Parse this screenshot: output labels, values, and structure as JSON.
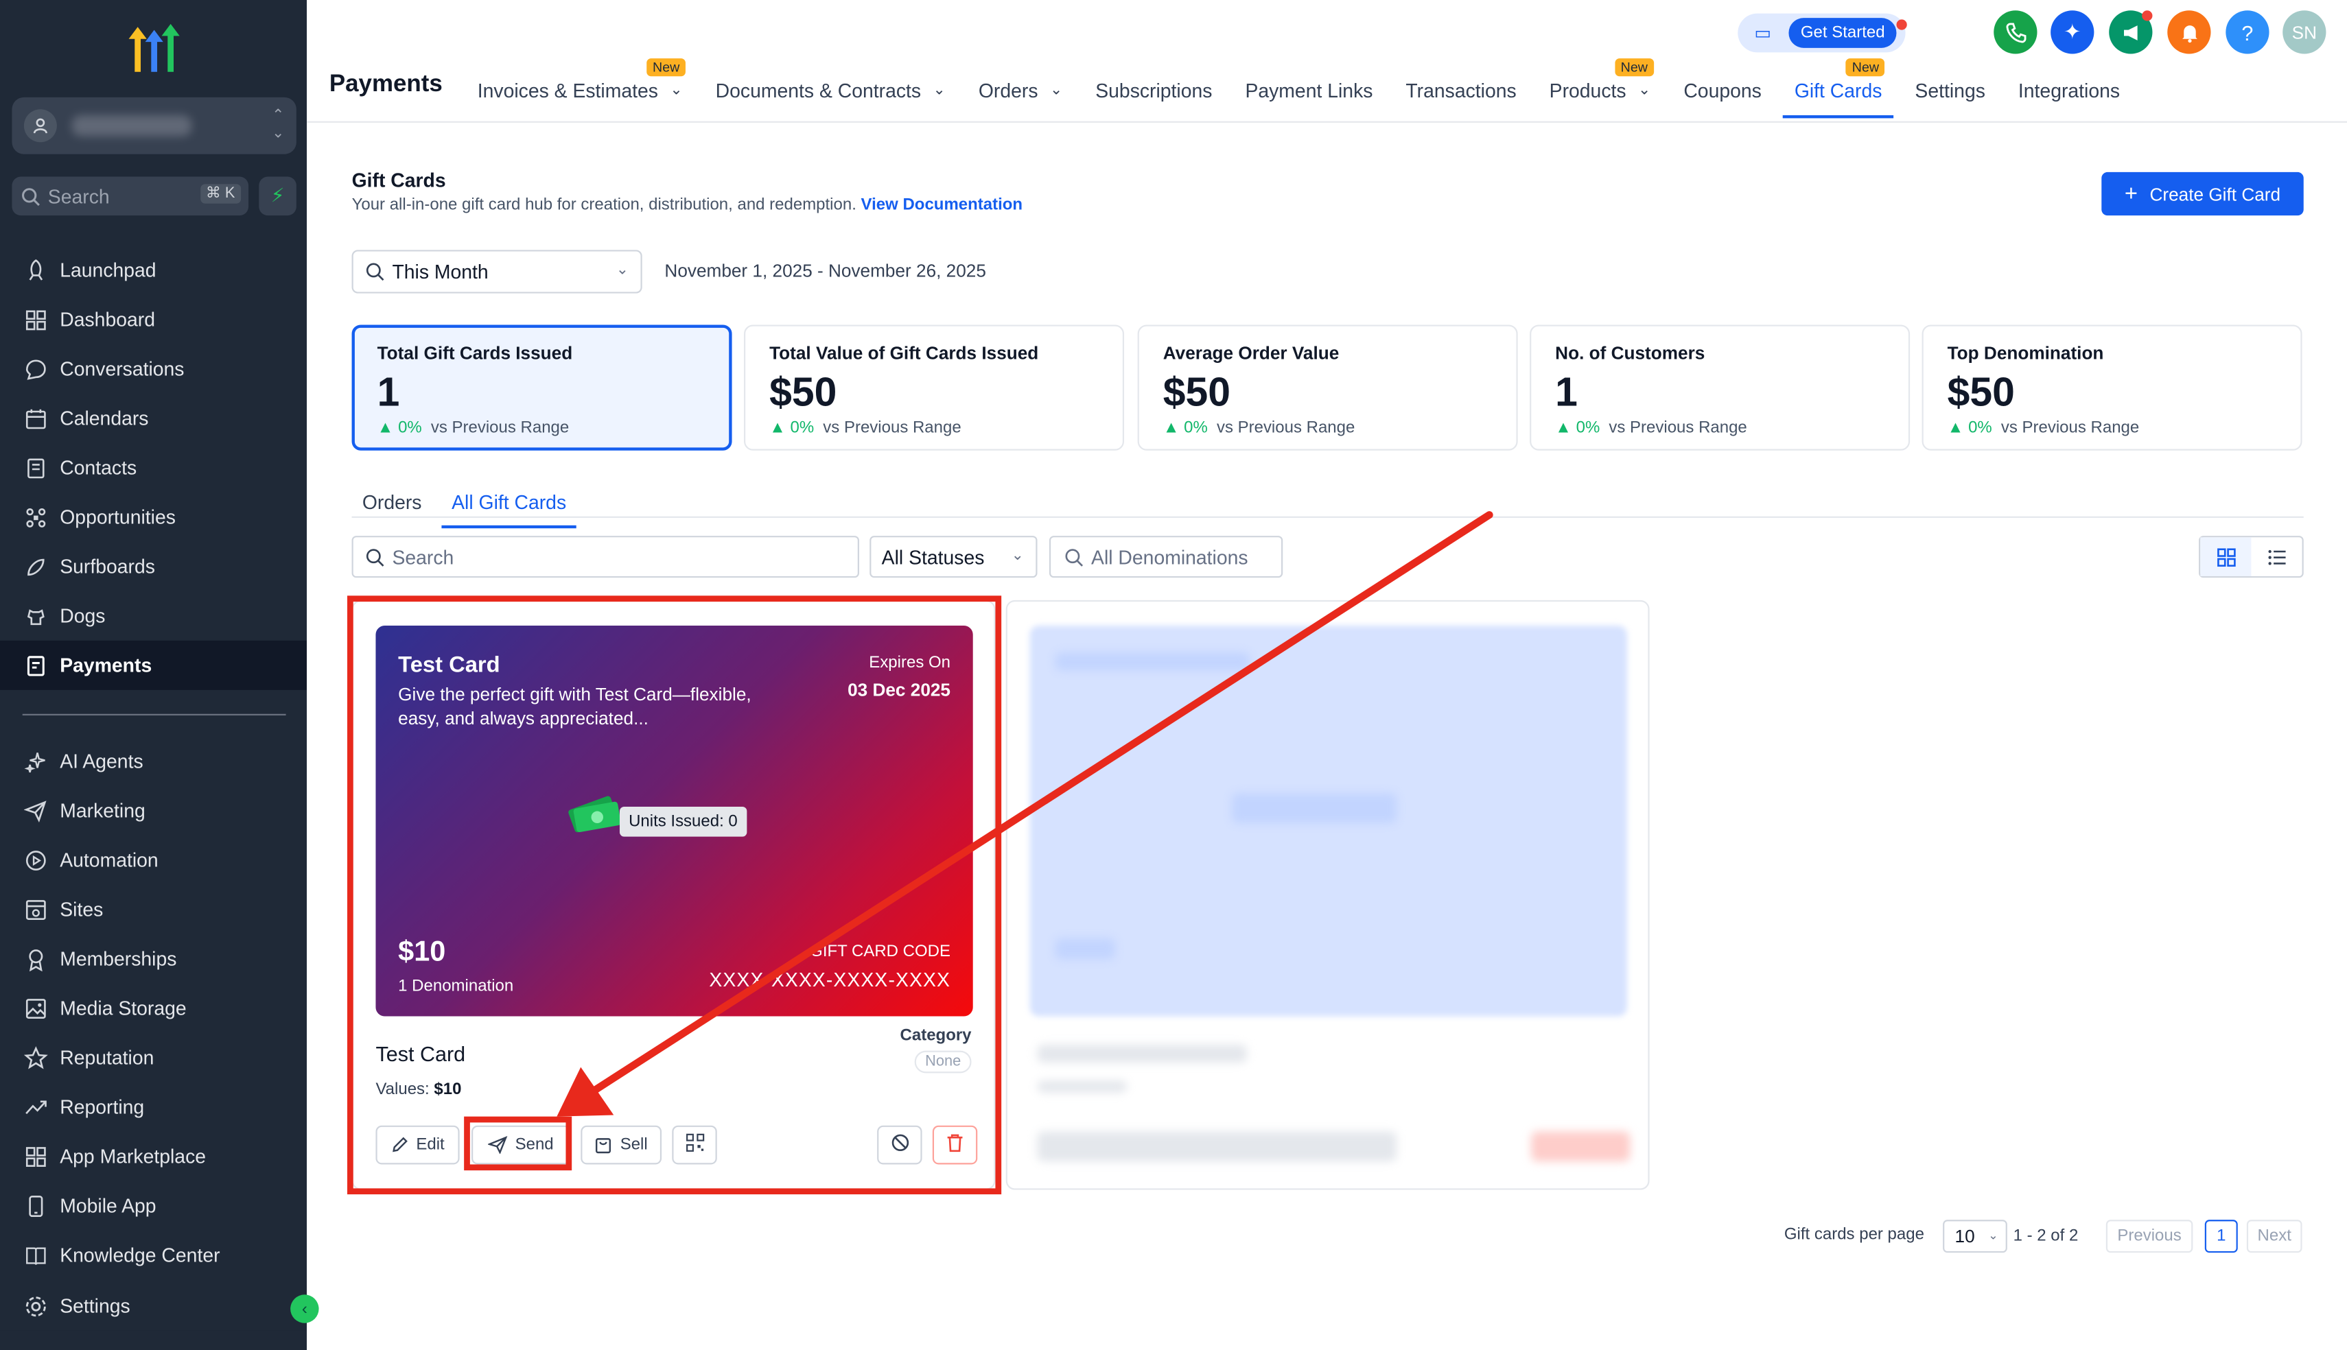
{
  "sidebar": {
    "search_placeholder": "Search",
    "search_shortcut": "⌘ K",
    "items": [
      {
        "label": "Launchpad",
        "icon": "rocket-icon"
      },
      {
        "label": "Dashboard",
        "icon": "dashboard-icon"
      },
      {
        "label": "Conversations",
        "icon": "chat-icon"
      },
      {
        "label": "Calendars",
        "icon": "calendar-icon"
      },
      {
        "label": "Contacts",
        "icon": "contacts-icon"
      },
      {
        "label": "Opportunities",
        "icon": "opportunities-icon"
      },
      {
        "label": "Surfboards",
        "icon": "surfboard-icon"
      },
      {
        "label": "Dogs",
        "icon": "dog-icon"
      },
      {
        "label": "Payments",
        "icon": "payments-icon"
      }
    ],
    "items2": [
      {
        "label": "AI Agents",
        "icon": "sparkle-icon"
      },
      {
        "label": "Marketing",
        "icon": "send-icon"
      },
      {
        "label": "Automation",
        "icon": "automation-icon"
      },
      {
        "label": "Sites",
        "icon": "sites-icon"
      },
      {
        "label": "Memberships",
        "icon": "memberships-icon"
      },
      {
        "label": "Media Storage",
        "icon": "media-icon"
      },
      {
        "label": "Reputation",
        "icon": "star-icon"
      },
      {
        "label": "Reporting",
        "icon": "chart-icon"
      },
      {
        "label": "App Marketplace",
        "icon": "grid-icon"
      },
      {
        "label": "Mobile App",
        "icon": "phone-icon"
      },
      {
        "label": "Knowledge Center",
        "icon": "book-icon"
      }
    ],
    "settings_label": "Settings"
  },
  "header": {
    "title": "Payments",
    "tabs": [
      {
        "label": "Invoices & Estimates",
        "badge": "New",
        "dropdown": true
      },
      {
        "label": "Documents & Contracts",
        "dropdown": true
      },
      {
        "label": "Orders",
        "dropdown": true
      },
      {
        "label": "Subscriptions"
      },
      {
        "label": "Payment Links"
      },
      {
        "label": "Transactions"
      },
      {
        "label": "Products",
        "badge": "New",
        "dropdown": true
      },
      {
        "label": "Coupons"
      },
      {
        "label": "Gift Cards",
        "badge": "New",
        "active": true
      },
      {
        "label": "Settings"
      },
      {
        "label": "Integrations"
      }
    ],
    "get_started": "Get Started",
    "avatar_initials": "SN",
    "help_glyph": "?"
  },
  "page": {
    "title": "Gift Cards",
    "subtitle": "Your all-in-one gift card hub for creation, distribution, and redemption.",
    "doc_link": "View Documentation",
    "create_button": "Create Gift Card",
    "range_value": "This Month",
    "date_range": "November 1, 2025 - November 26, 2025"
  },
  "stats": [
    {
      "label": "Total Gift Cards Issued",
      "value": "1",
      "pct": "0%",
      "compare": "vs Previous Range",
      "selected": true
    },
    {
      "label": "Total Value of Gift Cards Issued",
      "value": "$50",
      "pct": "0%",
      "compare": "vs Previous Range"
    },
    {
      "label": "Average Order Value",
      "value": "$50",
      "pct": "0%",
      "compare": "vs Previous Range"
    },
    {
      "label": "No. of Customers",
      "value": "1",
      "pct": "0%",
      "compare": "vs Previous Range"
    },
    {
      "label": "Top Denomination",
      "value": "$50",
      "pct": "0%",
      "compare": "vs Previous Range"
    }
  ],
  "subtabs": {
    "orders": "Orders",
    "all": "All Gift Cards"
  },
  "filters": {
    "search_placeholder": "Search",
    "status": "All Statuses",
    "denom_placeholder": "All Denominations"
  },
  "card": {
    "title": "Test Card",
    "description": "Give the perfect gift with Test Card—flexible, easy, and always appreciated...",
    "expires_label": "Expires On",
    "expires_value": "03 Dec 2025",
    "units_issued": "Units Issued: 0",
    "amount": "$10",
    "denomination": "1 Denomination",
    "code_label": "GIFT CARD CODE",
    "code_value": "XXXX-XXXX-XXXX-XXXX",
    "name": "Test Card",
    "category_label": "Category",
    "category_value": "None",
    "values_label": "Values:",
    "values_value": "$10",
    "actions": {
      "edit": "Edit",
      "send": "Send",
      "sell": "Sell"
    }
  },
  "pagination": {
    "per_page_label": "Gift cards per page",
    "per_page": "10",
    "range": "1 - 2 of 2",
    "previous": "Previous",
    "page": "1",
    "next": "Next"
  },
  "colors": {
    "primary": "#155eef",
    "sidebar": "#1f2937",
    "annotation": "#e8291c",
    "success": "#12b76a"
  }
}
